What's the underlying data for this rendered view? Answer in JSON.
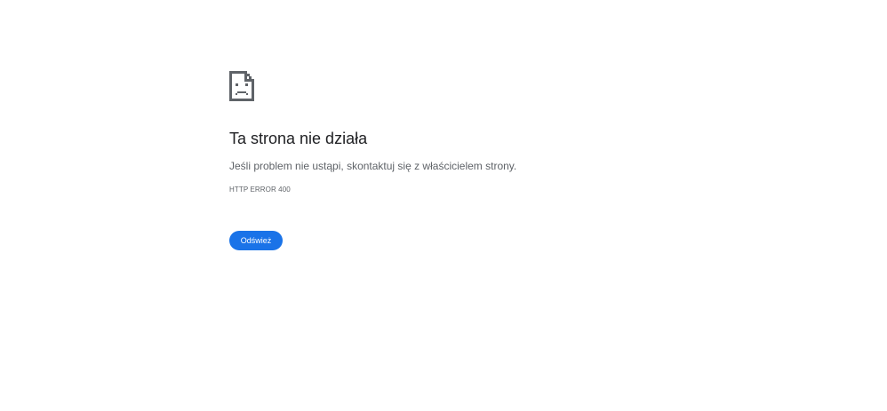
{
  "error": {
    "icon": "broken-page-sad-icon",
    "title": "Ta strona nie działa",
    "message": "Jeśli problem nie ustąpi, skontaktuj się z właścicielem strony.",
    "code": "HTTP ERROR 400",
    "reload_label": "Odśwież"
  },
  "colors": {
    "button_bg": "#1a73e8",
    "button_text": "#ffffff",
    "title_text": "#202124",
    "secondary_text": "#5f6368",
    "icon": "#5f6368"
  }
}
